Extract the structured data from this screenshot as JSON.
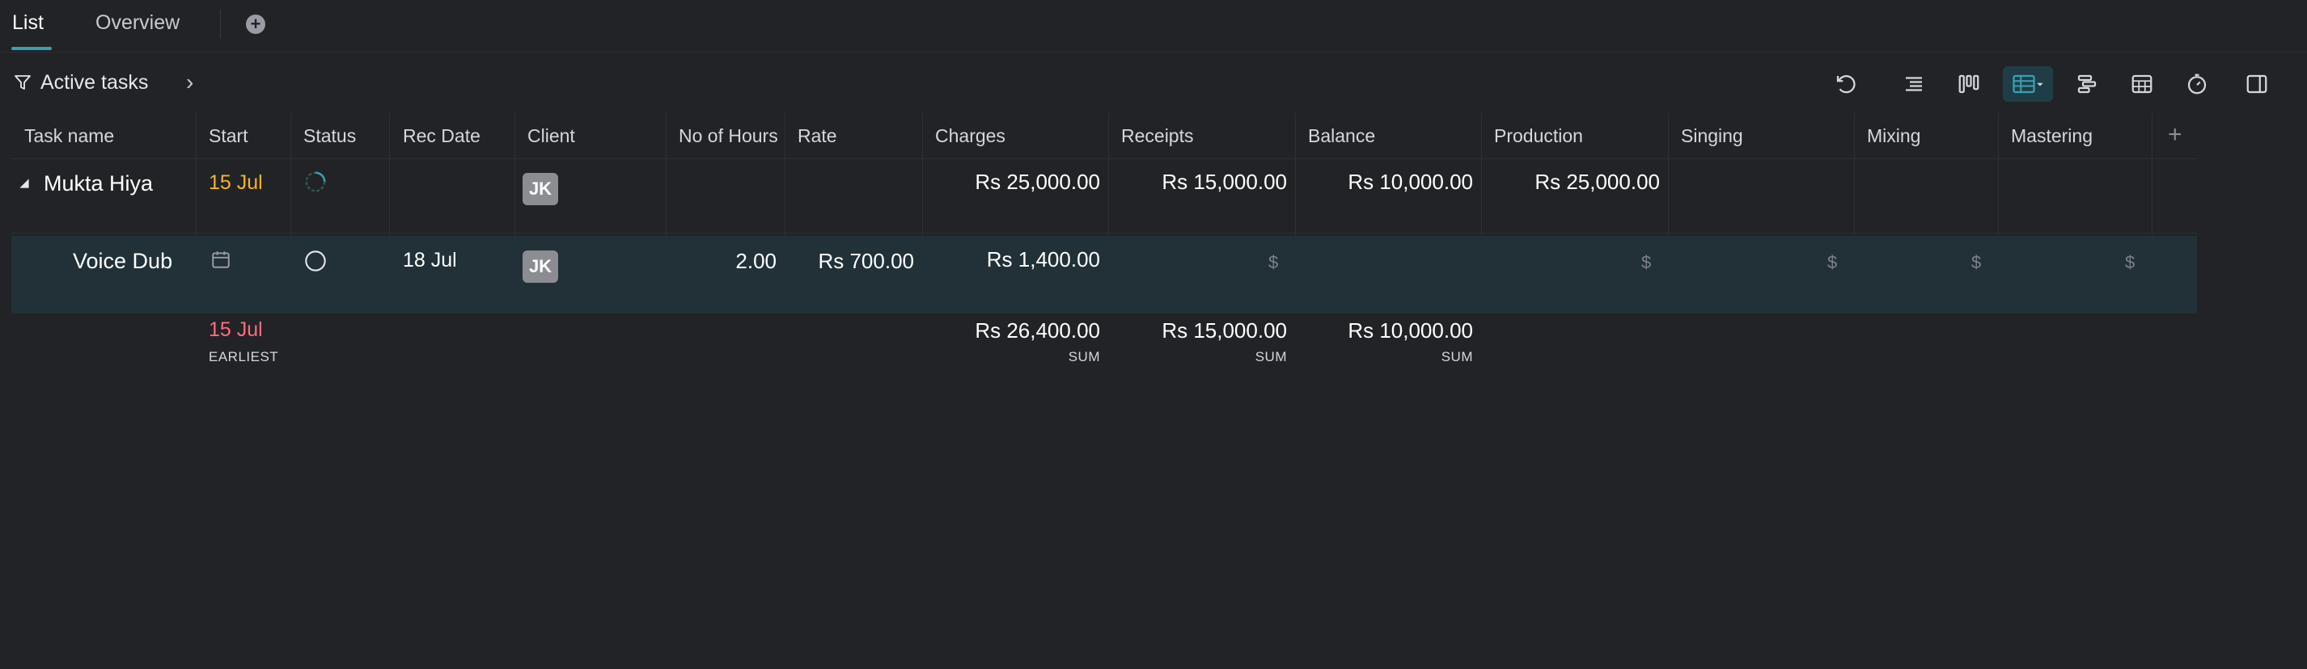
{
  "tabs": {
    "list": "List",
    "overview": "Overview"
  },
  "filter": {
    "label": "Active tasks"
  },
  "toolbar": {
    "icons": [
      "refresh-icon",
      "outline-view-icon",
      "board-view-icon",
      "table-view-icon",
      "gantt-view-icon",
      "calendar-view-icon",
      "timer-icon",
      "side-panel-icon"
    ],
    "active": "table-view-icon",
    "accent": "#3aa0b3"
  },
  "columns": [
    "Task name",
    "Start",
    "Status",
    "Rec Date",
    "Client",
    "No of Hours",
    "Rate",
    "Charges",
    "Receipts",
    "Balance",
    "Production",
    "Singing",
    "Mixing",
    "Mastering"
  ],
  "add_column": "+",
  "rows": [
    {
      "task": "Mukta Hiya",
      "start": "15 Jul",
      "client": "JK",
      "charges": "Rs 25,000.00",
      "receipts": "Rs 15,000.00",
      "balance": "Rs 10,000.00",
      "production": "Rs 25,000.00"
    },
    {
      "task": "Voice Dub",
      "rec_date": "18 Jul",
      "client": "JK",
      "hours": "2.00",
      "rate": "Rs 700.00",
      "charges": "Rs 1,400.00",
      "currency_placeholder": "$"
    }
  ],
  "summary": {
    "start": "15 Jul",
    "start_label": "EARLIEST",
    "charges": "Rs 26,400.00",
    "receipts": "Rs 15,000.00",
    "balance": "Rs 10,000.00",
    "sum_label": "SUM"
  },
  "colors": {
    "background": "#222326",
    "selected_row": "#213137",
    "start_date": "#f4b32a",
    "earliest_date": "#ff6b7f",
    "badge": "#8b8d92"
  }
}
